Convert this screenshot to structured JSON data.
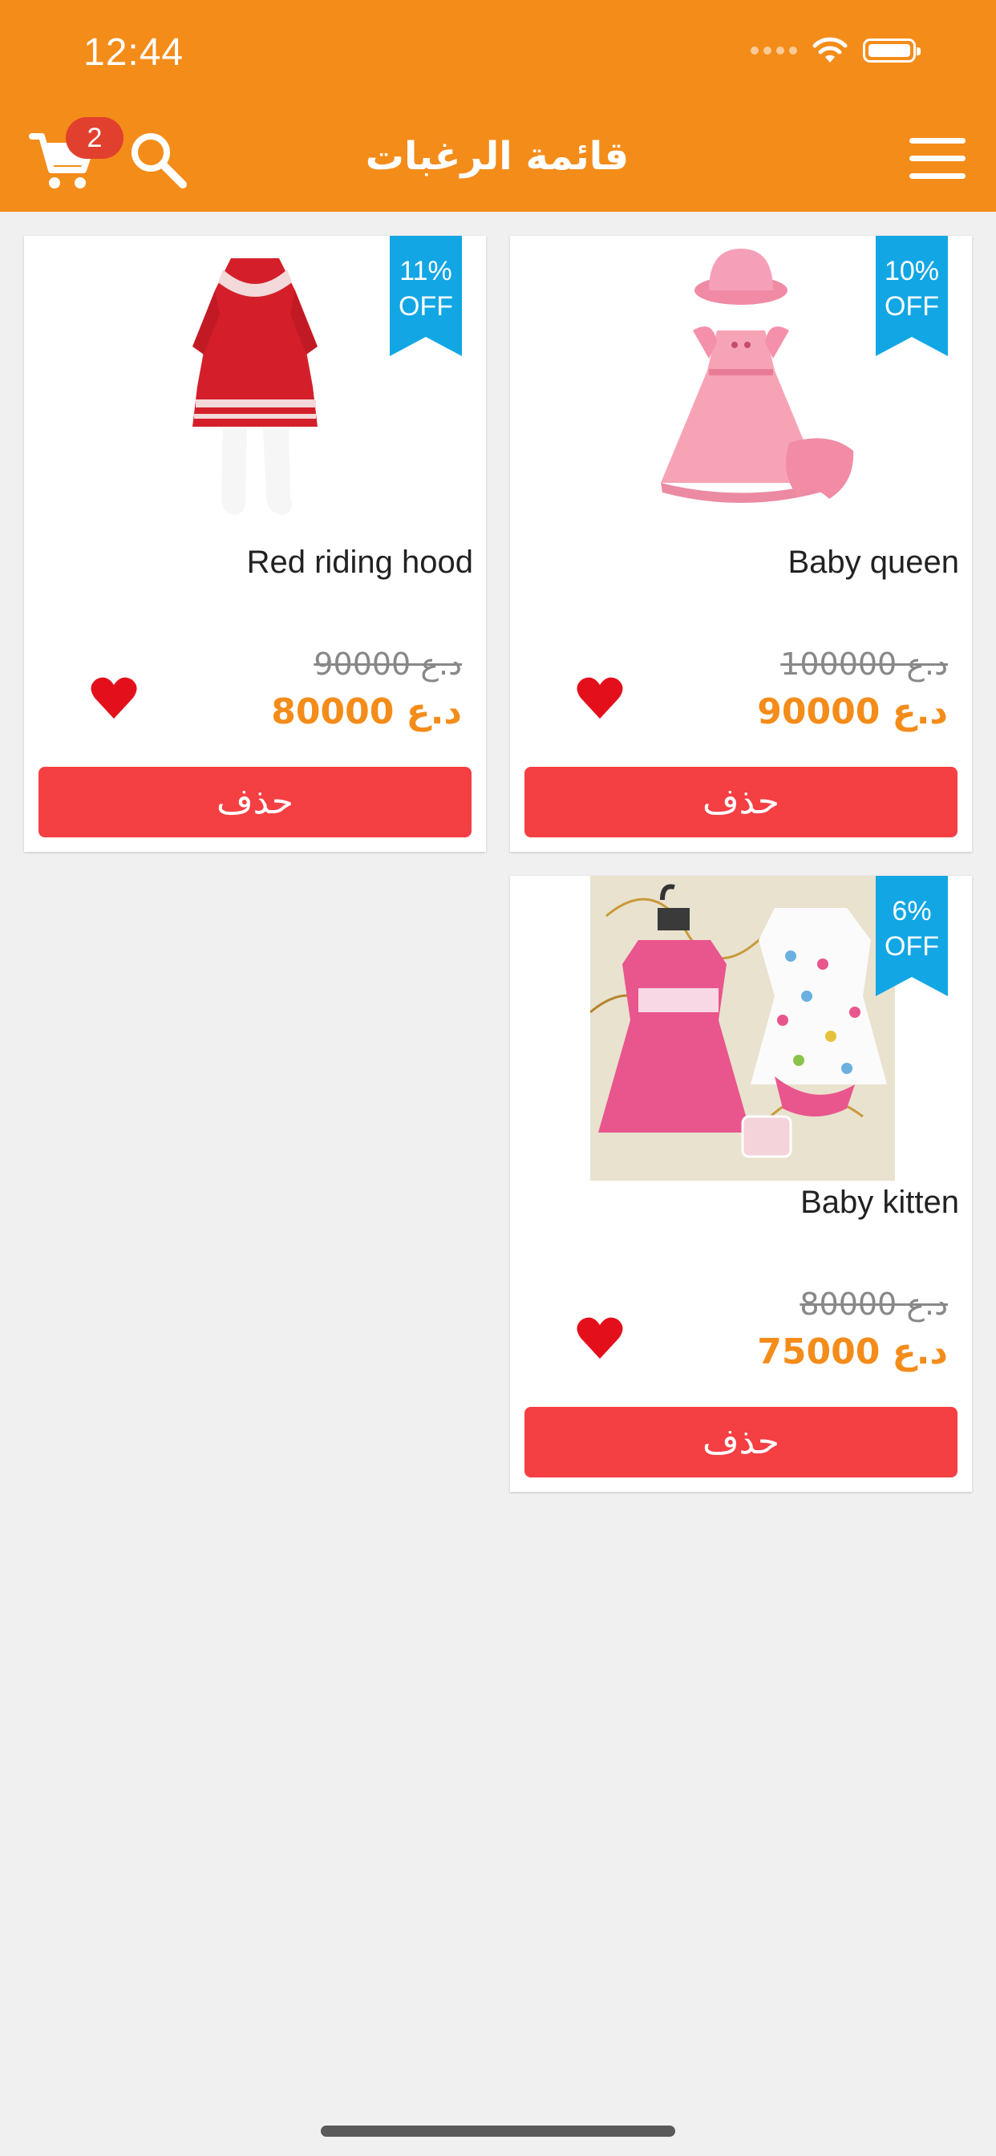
{
  "status_bar": {
    "time": "12:44"
  },
  "header": {
    "title": "قائمة الرغبات",
    "cart_count": "2",
    "background_color": "#f48c1a"
  },
  "icons": {
    "cart": "cart-icon",
    "search": "search-icon",
    "menu": "hamburger-menu-icon",
    "favorite": "heart-icon"
  },
  "products": [
    {
      "name": "Baby queen",
      "discount_percent": "10%",
      "discount_label": "OFF",
      "old_price": "100000 د.ع",
      "new_price": "90000 د.ع",
      "delete_label": "حذف"
    },
    {
      "name": "Red riding hood",
      "discount_percent": "11%",
      "discount_label": "OFF",
      "old_price": "90000 د.ع",
      "new_price": "80000 د.ع",
      "delete_label": "حذف"
    },
    {
      "name": "Baby kitten",
      "discount_percent": "6%",
      "discount_label": "OFF",
      "old_price": "80000 د.ع",
      "new_price": "75000 د.ع",
      "delete_label": "حذف"
    }
  ],
  "colors": {
    "accent": "#f48c1a",
    "ribbon": "#12a6e4",
    "delete_button": "#f43f43",
    "heart": "#e3101b",
    "badge": "#e2402f"
  }
}
